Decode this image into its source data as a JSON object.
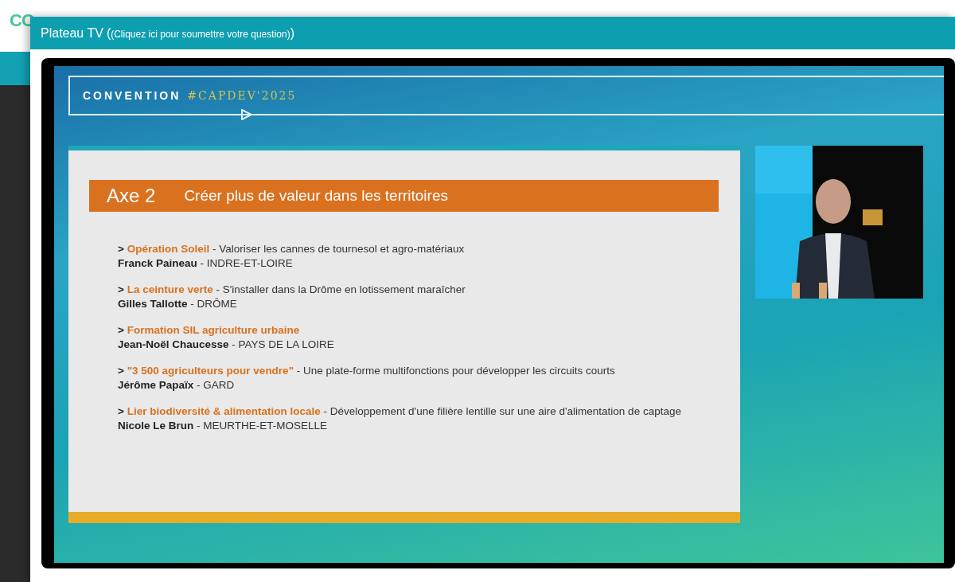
{
  "page": {
    "logo": "CO"
  },
  "modal": {
    "title": "Plateau TV",
    "open_paren": "(",
    "subtitle": "(Cliquez ici pour soumettre votre question)",
    "close_paren": ")"
  },
  "slide": {
    "brand": "CONVENTION",
    "hashtag": "#CAPDEV'2025",
    "axis_label": "Axe 2",
    "axis_title": "Créer plus de valeur dans les territoires",
    "items": [
      {
        "bullet": ">",
        "title": "Opération Soleil",
        "description": "- Valoriser les cannes de tournesol et agro-matériaux",
        "name": "Franck Paineau",
        "region": "- INDRE-ET-LOIRE"
      },
      {
        "bullet": ">",
        "title": "La ceinture verte",
        "description": "- S'installer dans la Drôme en lotissement maraîcher",
        "name": "Gilles Tallotte",
        "region": "- DRÔME"
      },
      {
        "bullet": ">",
        "title": "Formation SIL agriculture urbaine",
        "name": "Jean-Noël Chaucesse",
        "region": "- PAYS DE LA LOIRE"
      },
      {
        "bullet": ">",
        "title": "\"3 500 agriculteurs pour vendre\"",
        "description": "- Une plate-forme multifonctions pour développer les circuits courts",
        "name": "Jérôme Papaïx",
        "region": "- GARD"
      },
      {
        "bullet": ">",
        "title": "Lier biodiversité & alimentation locale",
        "description": "- Développement d'une filière lentille sur une aire d'alimentation de captage",
        "name": "Nicole Le Brun",
        "region": "- MEURTHE-ET-MOSELLE"
      }
    ]
  }
}
